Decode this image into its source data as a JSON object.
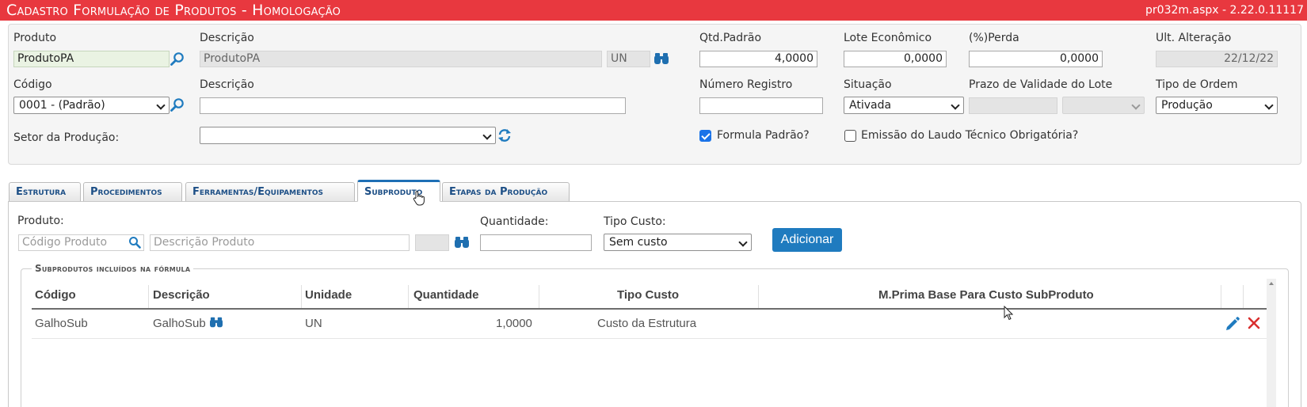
{
  "titlebar": {
    "title": "Cadastro Formulação de Produtos  - Homologação",
    "version": "pr032m.aspx - 2.22.0.11117"
  },
  "header": {
    "produto": {
      "label": "Produto",
      "value": "ProdutoPA"
    },
    "descricao": {
      "label": "Descrição",
      "value": "ProdutoPA",
      "unit": "UN"
    },
    "qtd_padrao": {
      "label": "Qtd.Padrão",
      "value": "4,0000"
    },
    "lote_economico": {
      "label": "Lote Econômico",
      "value": "0,0000"
    },
    "perda": {
      "label": "(%)Perda",
      "value": "0,0000"
    },
    "ult_alteracao": {
      "label": "Ult. Alteração",
      "value": "22/12/22"
    },
    "codigo": {
      "label": "Código",
      "value": "0001 - (Padrão)"
    },
    "descricao2": {
      "label": "Descrição",
      "value": ""
    },
    "numero_registro": {
      "label": "Número Registro",
      "value": ""
    },
    "situacao": {
      "label": "Situação",
      "value": "Ativada"
    },
    "prazo_validade": {
      "label": "Prazo de Validade do Lote",
      "value": "",
      "unit": ""
    },
    "tipo_ordem": {
      "label": "Tipo de Ordem",
      "value": "Produção"
    },
    "setor_producao": {
      "label": "Setor da Produção:",
      "value": ""
    },
    "formula_padrao": {
      "label": "Formula Padrão?",
      "checked": true
    },
    "emissao_laudo": {
      "label": "Emissão do Laudo Técnico Obrigatória?",
      "checked": false
    }
  },
  "tabs": [
    {
      "label": "Estrutura",
      "active": false
    },
    {
      "label": "Procedimentos",
      "active": false
    },
    {
      "label": "Ferramentas/Equipamentos",
      "active": false
    },
    {
      "label": "Subproduto",
      "active": true
    },
    {
      "label": "Etapas da Produção",
      "active": false
    }
  ],
  "subproduto_form": {
    "produto_label": "Produto:",
    "codigo_placeholder": "Código Produto",
    "descricao_placeholder": "Descrição Produto",
    "quantidade_label": "Quantidade:",
    "quantidade_value": "",
    "tipo_custo_label": "Tipo Custo:",
    "tipo_custo_value": "Sem custo",
    "adicionar_label": "Adicionar"
  },
  "subprodutos_grid": {
    "legend": "Subprodutos incluídos na fórmula",
    "columns": [
      "Código",
      "Descrição",
      "Unidade",
      "Quantidade",
      "Tipo Custo",
      "M.Prima Base Para Custo SubProduto"
    ],
    "rows": [
      {
        "codigo": "GalhoSub",
        "descricao": "GalhoSub",
        "unidade": "UN",
        "quantidade": "1,0000",
        "tipo_custo": "Custo da Estrutura",
        "mprima": ""
      }
    ]
  },
  "colors": {
    "titlebar": "#e8383f",
    "accent": "#1f7bbf",
    "delete": "#d9302f",
    "tab_text": "#1d4f86"
  }
}
